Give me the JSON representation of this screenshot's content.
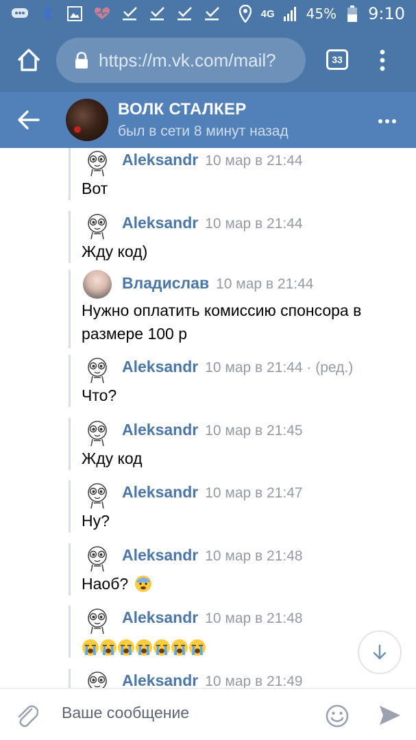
{
  "status_bar": {
    "battery": "45%",
    "network": "4G",
    "time": "9:10"
  },
  "browser": {
    "url": "https://m.vk.com/mail?",
    "tabs_count": "33"
  },
  "chat_header": {
    "title": "ВОЛК СТАЛКЕР",
    "status": "был в сети 8 минут назад"
  },
  "messages": [
    {
      "author": "Aleksandr",
      "time": "10 мар в 21:44",
      "edited": "",
      "text": "Вот",
      "avatar": "meme-face"
    },
    {
      "author": "Aleksandr",
      "time": "10 мар в 21:44",
      "edited": "",
      "text": "Жду код)",
      "avatar": "meme-face"
    },
    {
      "author": "Владислав",
      "time": "10 мар в 21:44",
      "edited": "",
      "text": "Нужно оплатить комиссию спонсора в размере 100 р",
      "avatar": "girl-face"
    },
    {
      "author": "Aleksandr",
      "time": "10 мар в 21:44",
      "edited": " · (ред.)",
      "text": "Что?",
      "avatar": "meme-face"
    },
    {
      "author": "Aleksandr",
      "time": "10 мар в 21:45",
      "edited": "",
      "text": "Жду код",
      "avatar": "meme-face"
    },
    {
      "author": "Aleksandr",
      "time": "10 мар в 21:47",
      "edited": "",
      "text": "Ну?",
      "avatar": "meme-face"
    },
    {
      "author": "Aleksandr",
      "time": "10 мар в 21:48",
      "edited": "",
      "text": "Наоб?",
      "avatar": "meme-face",
      "emoji": "fearful-face"
    },
    {
      "author": "Aleksandr",
      "time": "10 мар в 21:48",
      "edited": "",
      "text": "",
      "avatar": "meme-face",
      "emoji_row": "loudly-crying-face x7"
    },
    {
      "author": "Aleksandr",
      "time": "10 мар в 21:49",
      "edited": "",
      "text": "",
      "avatar": "meme-face"
    }
  ],
  "composer": {
    "placeholder": "Ваше сообщение"
  },
  "colors": {
    "vk_blue": "#4a76a8",
    "header_blue": "#5181b8",
    "name_blue": "#4a76a8",
    "time_gray": "#939aa3"
  }
}
